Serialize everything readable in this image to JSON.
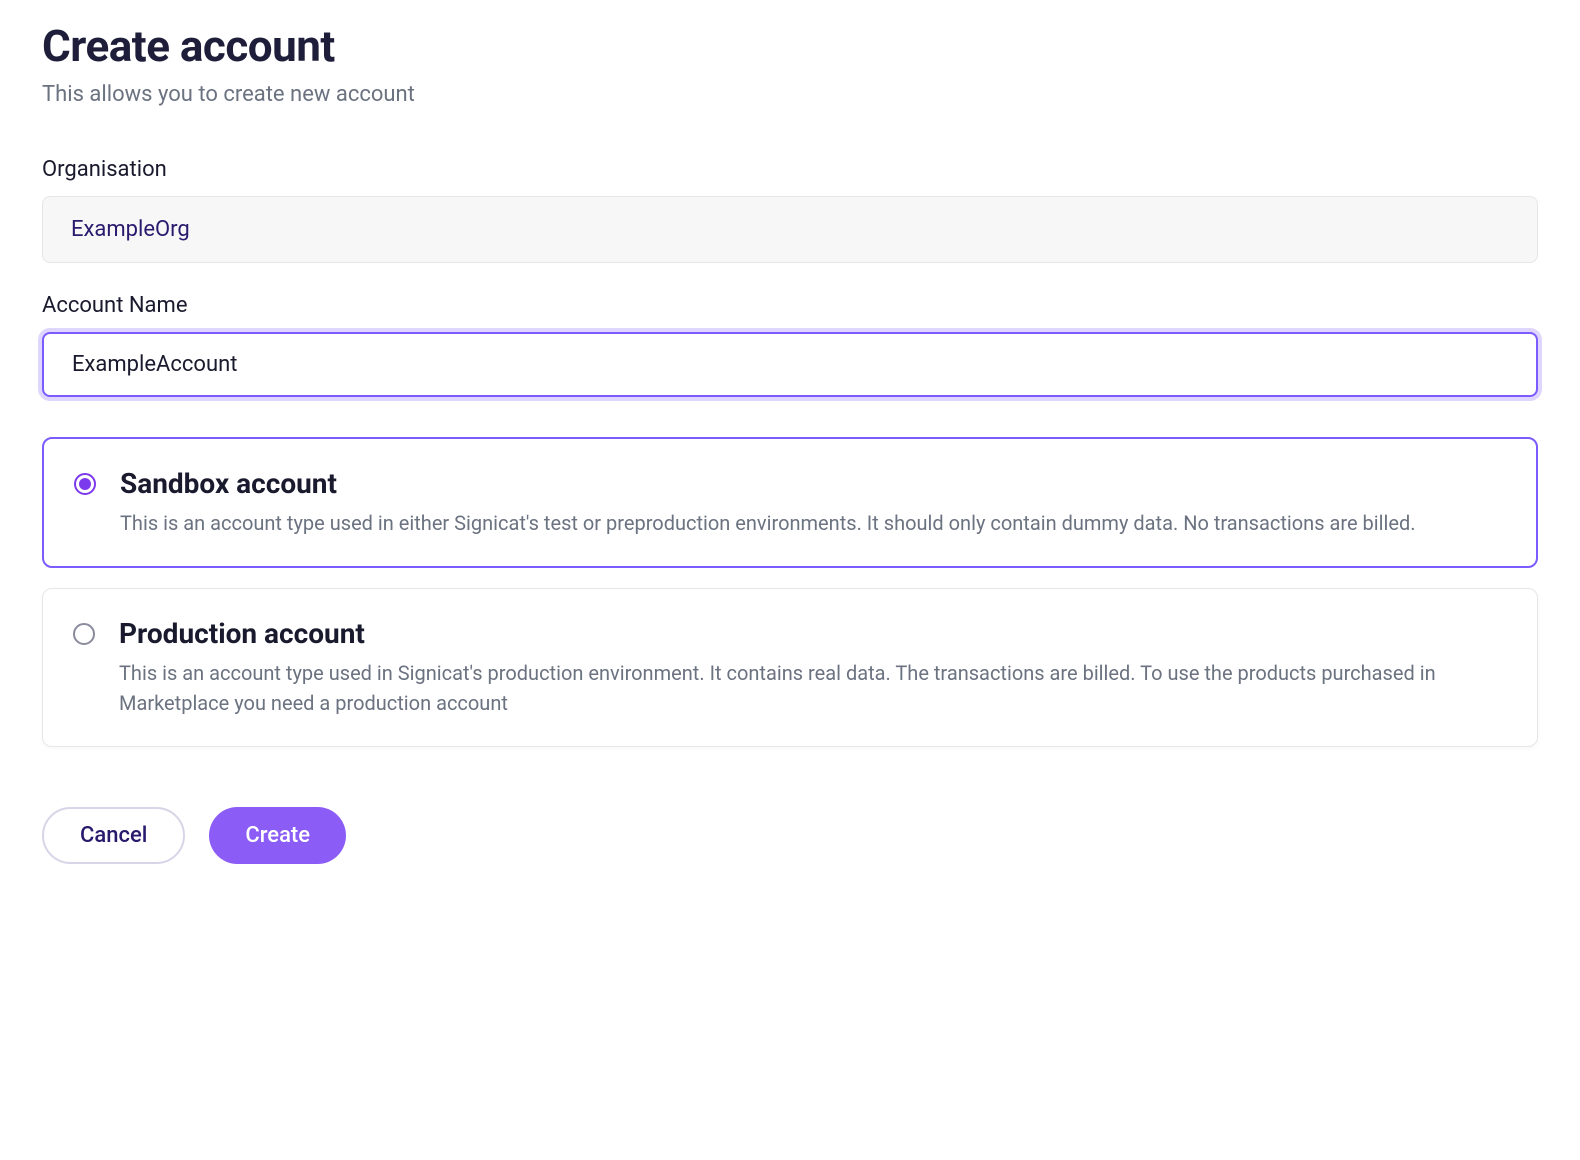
{
  "header": {
    "title": "Create account",
    "subtitle": "This allows you to create new account"
  },
  "form": {
    "organisation": {
      "label": "Organisation",
      "value": "ExampleOrg"
    },
    "account_name": {
      "label": "Account Name",
      "value": "ExampleAccount"
    }
  },
  "options": {
    "sandbox": {
      "title": "Sandbox account",
      "description": "This is an account type used in either Signicat's test or preproduction environments. It should only contain dummy data. No transactions are billed.",
      "selected": true
    },
    "production": {
      "title": "Production account",
      "description": "This is an account type used in Signicat's production environment. It contains real data. The transactions are billed. To use the products purchased in Marketplace you need a production account",
      "selected": false
    }
  },
  "buttons": {
    "cancel": "Cancel",
    "create": "Create"
  }
}
